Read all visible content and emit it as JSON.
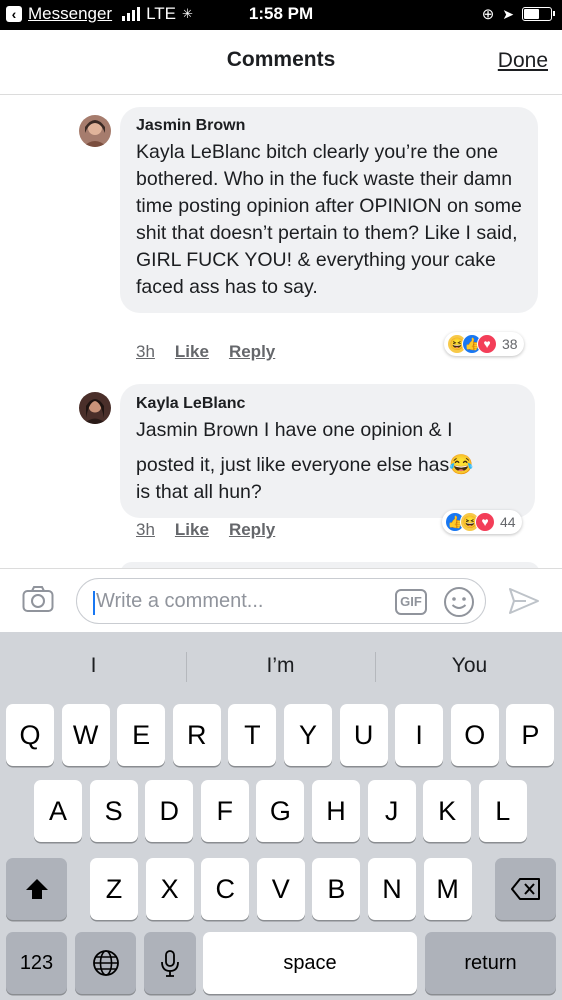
{
  "status_bar": {
    "back_app": "Messenger",
    "carrier": "LTE",
    "time": "1:58 PM",
    "battery_level": 0.6
  },
  "header": {
    "title": "Comments",
    "done_label": "Done"
  },
  "comments": [
    {
      "author": "Jasmin Brown",
      "text": "Kayla LeBlanc bitch clearly you’re the one bothered. Who in the fuck waste their damn time posting opinion after OPINION on some shit that doesn’t pertain to them? Like I said, GIRL FUCK YOU! & everything your cake faced ass has to say.",
      "time": "3h",
      "like_label": "Like",
      "reply_label": "Reply",
      "reactions": [
        "haha",
        "like",
        "love"
      ],
      "reaction_count": "38"
    },
    {
      "author": "Kayla LeBlanc",
      "text_line1": "Jasmin Brown I have one opinion & I",
      "text_line2": "posted it, just like everyone else has",
      "text_emoji": "😂",
      "text_line3": "is that all hun?",
      "time": "3h",
      "like_label": "Like",
      "reply_label": "Reply",
      "reactions": [
        "like",
        "haha",
        "love"
      ],
      "reaction_count": "44"
    }
  ],
  "composer": {
    "placeholder": "Write a comment...",
    "gif_label": "GIF"
  },
  "keyboard": {
    "suggestions": [
      "I",
      "I’m",
      "You"
    ],
    "row1": [
      "Q",
      "W",
      "E",
      "R",
      "T",
      "Y",
      "U",
      "I",
      "O",
      "P"
    ],
    "row2": [
      "A",
      "S",
      "D",
      "F",
      "G",
      "H",
      "J",
      "K",
      "L"
    ],
    "row3": [
      "Z",
      "X",
      "C",
      "V",
      "B",
      "N",
      "M"
    ],
    "numbers_label": "123",
    "space_label": "space",
    "return_label": "return"
  },
  "colors": {
    "accent": "#1877f2",
    "bubble": "#f0f1f3",
    "keyboard_bg": "#d1d4d9"
  }
}
